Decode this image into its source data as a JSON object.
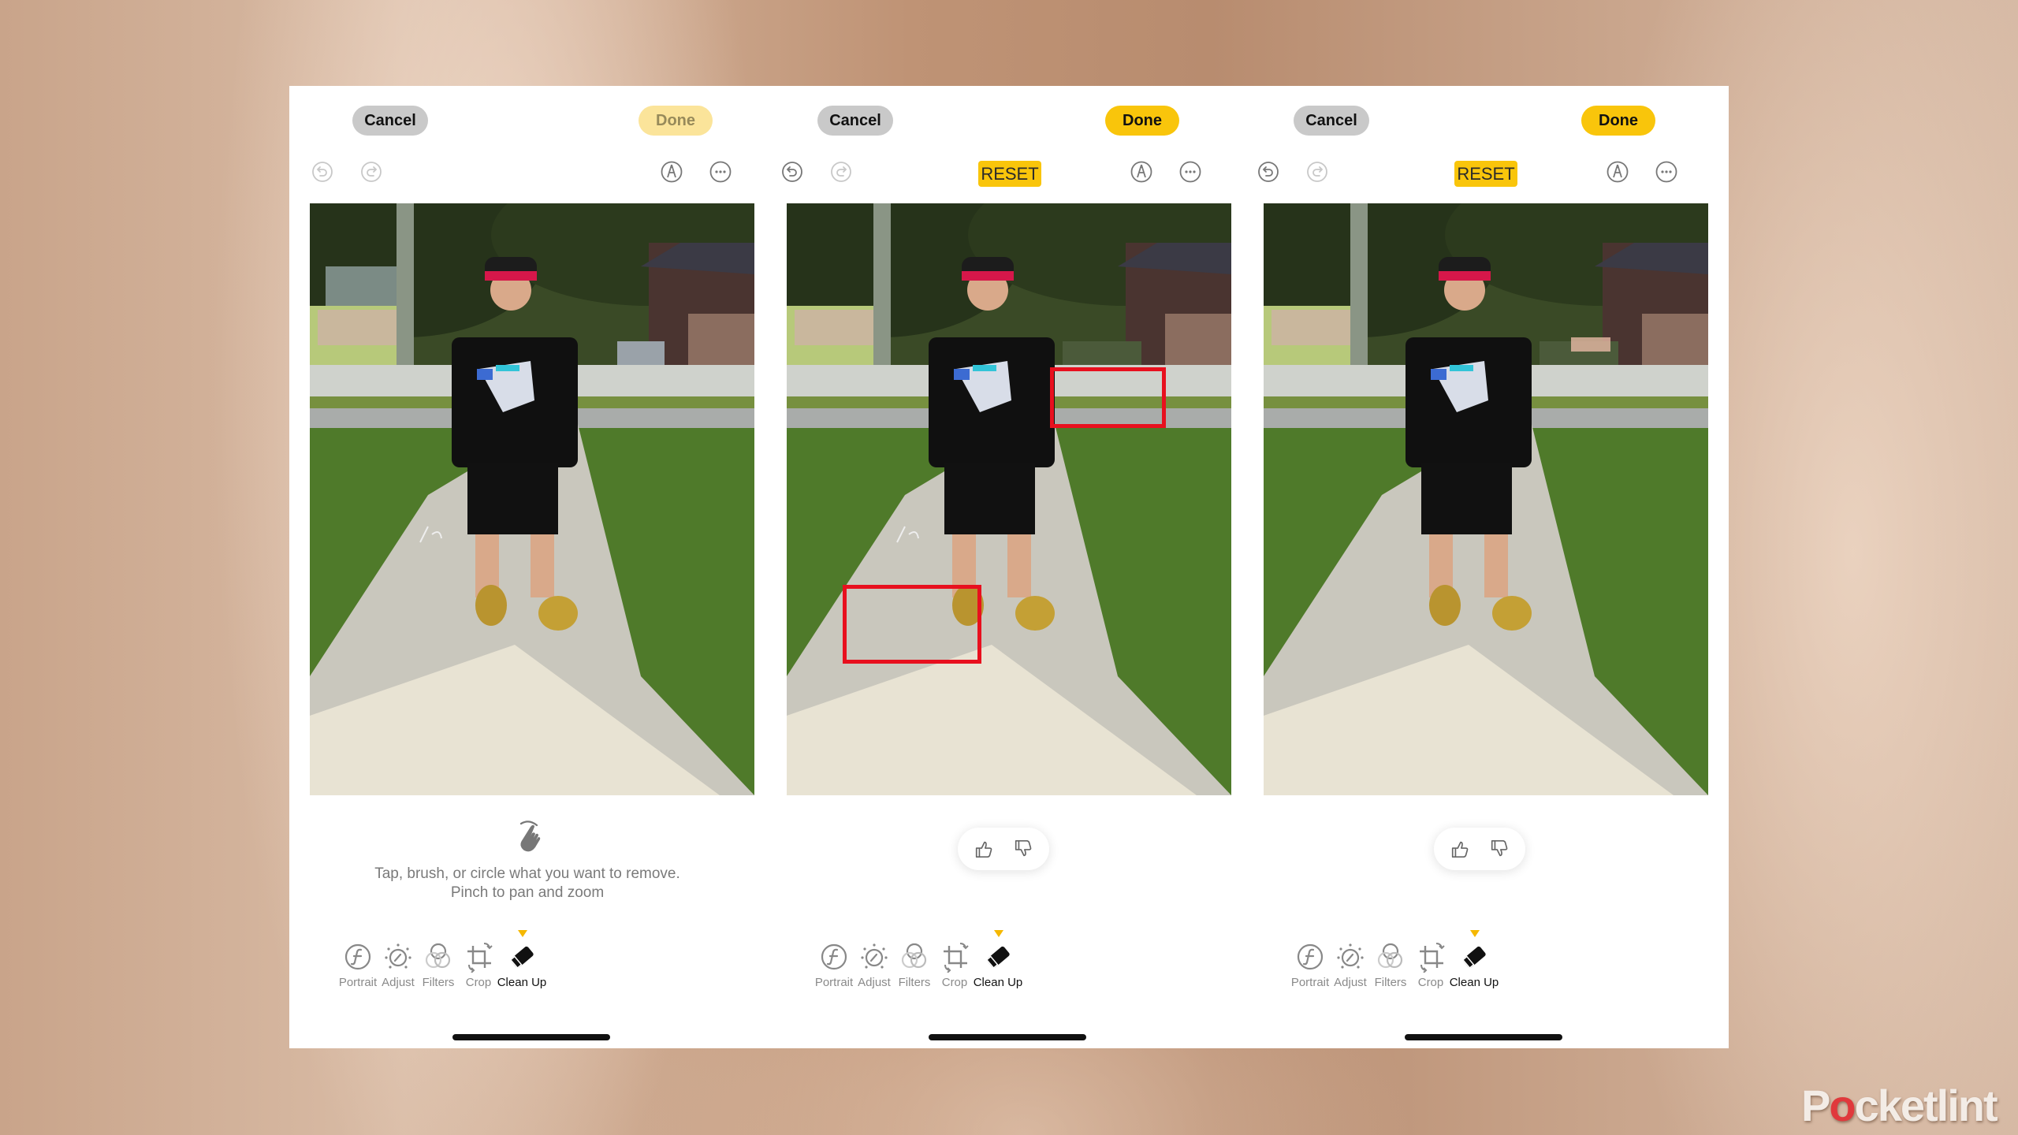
{
  "watermark": {
    "before": "P",
    "power_o": "o",
    "after": "cketlint",
    "accent_color": "#e0393c"
  },
  "colors": {
    "accent_yellow": "#f9c50b",
    "annotation_red": "#e8101e",
    "cancel_gray": "#c9c9c9"
  },
  "panels": [
    {
      "state": "before",
      "cancel_label": "Cancel",
      "done_label": "Done",
      "done_enabled": false,
      "undo_enabled": false,
      "redo_enabled": false,
      "reset_label": null,
      "photo_alt": "Boy in cap and black t-shirt standing on sidewalk, car and chalk marking visible",
      "hint": {
        "line1": "Tap, brush, or circle what you want to remove.",
        "line2": "Pinch to pan and zoom"
      },
      "highlight_boxes": []
    },
    {
      "state": "annotated",
      "cancel_label": "Cancel",
      "done_label": "Done",
      "done_enabled": true,
      "undo_enabled": true,
      "redo_enabled": false,
      "reset_label": "RESET",
      "photo_alt": "Same photo with car and chalk marking removed, red boxes highlighting cleaned areas",
      "feedback": {
        "thumbs_up": "thumbs-up",
        "thumbs_down": "thumbs-down"
      },
      "highlight_boxes": [
        {
          "target": "removed-car"
        },
        {
          "target": "removed-chalk"
        }
      ]
    },
    {
      "state": "after",
      "cancel_label": "Cancel",
      "done_label": "Done",
      "done_enabled": true,
      "undo_enabled": true,
      "redo_enabled": false,
      "reset_label": "RESET",
      "photo_alt": "Cleaned-up photo with car and chalk removed",
      "feedback": {
        "thumbs_up": "thumbs-up",
        "thumbs_down": "thumbs-down"
      },
      "highlight_boxes": []
    }
  ],
  "tools": [
    {
      "label": "Portrait",
      "icon": "portrait-f-icon",
      "active": false
    },
    {
      "label": "Adjust",
      "icon": "adjust-dial-icon",
      "active": false
    },
    {
      "label": "Filters",
      "icon": "filters-circles-icon",
      "active": false
    },
    {
      "label": "Crop",
      "icon": "crop-rotate-icon",
      "active": false
    },
    {
      "label": "Clean Up",
      "icon": "eraser-icon",
      "active": true
    }
  ]
}
